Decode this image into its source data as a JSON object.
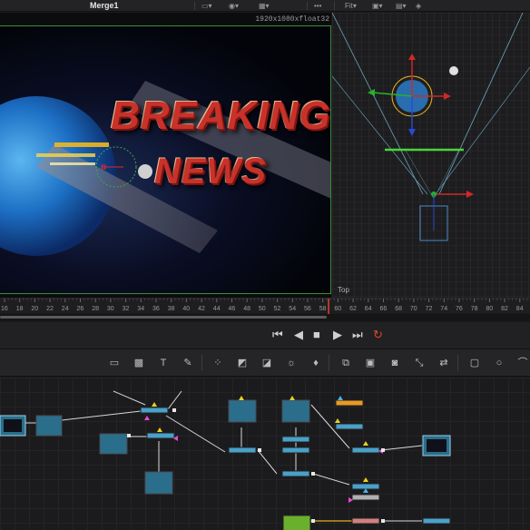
{
  "title_bar": {
    "node_title": "Merge1",
    "fit_label": "Fit"
  },
  "viewer": {
    "resolution": "1920x1080xfloat32",
    "headline_line1": "BREAKING",
    "headline_line2": "NEWS"
  },
  "viewer_3d": {
    "view_label": "Top"
  },
  "timeline": {
    "ticks": [
      "16",
      "18",
      "20",
      "22",
      "24",
      "26",
      "28",
      "30",
      "32",
      "34",
      "36",
      "38",
      "40",
      "42",
      "44",
      "46",
      "48",
      "50",
      "52",
      "54",
      "56",
      "58",
      "60",
      "62",
      "64",
      "66",
      "68",
      "70",
      "72",
      "74",
      "76",
      "78",
      "80",
      "82",
      "84"
    ],
    "progress": 0.62
  },
  "transport": {
    "buttons": [
      "go-to-start",
      "step-back",
      "stop",
      "play",
      "go-to-end",
      "loop"
    ]
  },
  "toolbar": {
    "tools": [
      "background",
      "paint-mask",
      "text",
      "brush",
      "particles",
      "blur",
      "color-correct",
      "brightness",
      "drop",
      "merge",
      "channel-booleans",
      "matte",
      "resize",
      "transform",
      "polygon-mask",
      "ellipse-mask",
      "bspline-mask"
    ]
  },
  "colors": {
    "accent_red": "#e0442c",
    "node_blue": "#2a6e8c",
    "node_orange": "#e89a22",
    "node_green": "#6ab02c",
    "viewer_border": "#3c8d3a",
    "headline_red": "#c8322a"
  }
}
